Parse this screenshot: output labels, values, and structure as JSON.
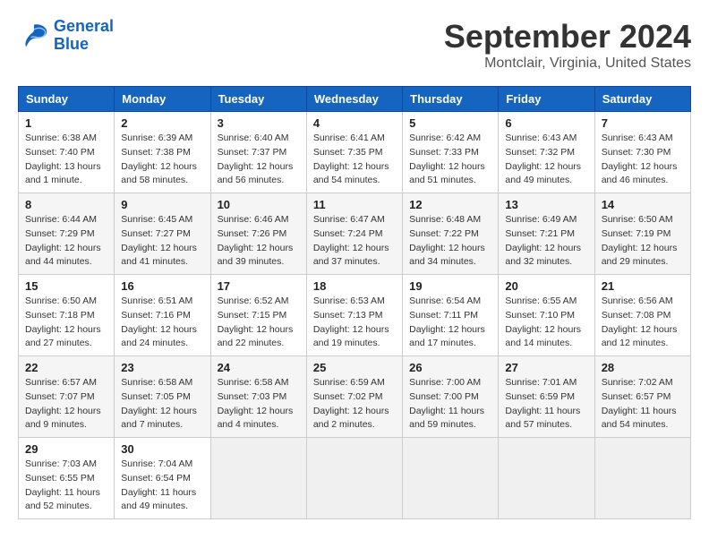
{
  "header": {
    "logo_line1": "General",
    "logo_line2": "Blue",
    "title": "September 2024",
    "subtitle": "Montclair, Virginia, United States"
  },
  "columns": [
    "Sunday",
    "Monday",
    "Tuesday",
    "Wednesday",
    "Thursday",
    "Friday",
    "Saturday"
  ],
  "weeks": [
    [
      {
        "day": "1",
        "info": "Sunrise: 6:38 AM\nSunset: 7:40 PM\nDaylight: 13 hours\nand 1 minute."
      },
      {
        "day": "2",
        "info": "Sunrise: 6:39 AM\nSunset: 7:38 PM\nDaylight: 12 hours\nand 58 minutes."
      },
      {
        "day": "3",
        "info": "Sunrise: 6:40 AM\nSunset: 7:37 PM\nDaylight: 12 hours\nand 56 minutes."
      },
      {
        "day": "4",
        "info": "Sunrise: 6:41 AM\nSunset: 7:35 PM\nDaylight: 12 hours\nand 54 minutes."
      },
      {
        "day": "5",
        "info": "Sunrise: 6:42 AM\nSunset: 7:33 PM\nDaylight: 12 hours\nand 51 minutes."
      },
      {
        "day": "6",
        "info": "Sunrise: 6:43 AM\nSunset: 7:32 PM\nDaylight: 12 hours\nand 49 minutes."
      },
      {
        "day": "7",
        "info": "Sunrise: 6:43 AM\nSunset: 7:30 PM\nDaylight: 12 hours\nand 46 minutes."
      }
    ],
    [
      {
        "day": "8",
        "info": "Sunrise: 6:44 AM\nSunset: 7:29 PM\nDaylight: 12 hours\nand 44 minutes."
      },
      {
        "day": "9",
        "info": "Sunrise: 6:45 AM\nSunset: 7:27 PM\nDaylight: 12 hours\nand 41 minutes."
      },
      {
        "day": "10",
        "info": "Sunrise: 6:46 AM\nSunset: 7:26 PM\nDaylight: 12 hours\nand 39 minutes."
      },
      {
        "day": "11",
        "info": "Sunrise: 6:47 AM\nSunset: 7:24 PM\nDaylight: 12 hours\nand 37 minutes."
      },
      {
        "day": "12",
        "info": "Sunrise: 6:48 AM\nSunset: 7:22 PM\nDaylight: 12 hours\nand 34 minutes."
      },
      {
        "day": "13",
        "info": "Sunrise: 6:49 AM\nSunset: 7:21 PM\nDaylight: 12 hours\nand 32 minutes."
      },
      {
        "day": "14",
        "info": "Sunrise: 6:50 AM\nSunset: 7:19 PM\nDaylight: 12 hours\nand 29 minutes."
      }
    ],
    [
      {
        "day": "15",
        "info": "Sunrise: 6:50 AM\nSunset: 7:18 PM\nDaylight: 12 hours\nand 27 minutes."
      },
      {
        "day": "16",
        "info": "Sunrise: 6:51 AM\nSunset: 7:16 PM\nDaylight: 12 hours\nand 24 minutes."
      },
      {
        "day": "17",
        "info": "Sunrise: 6:52 AM\nSunset: 7:15 PM\nDaylight: 12 hours\nand 22 minutes."
      },
      {
        "day": "18",
        "info": "Sunrise: 6:53 AM\nSunset: 7:13 PM\nDaylight: 12 hours\nand 19 minutes."
      },
      {
        "day": "19",
        "info": "Sunrise: 6:54 AM\nSunset: 7:11 PM\nDaylight: 12 hours\nand 17 minutes."
      },
      {
        "day": "20",
        "info": "Sunrise: 6:55 AM\nSunset: 7:10 PM\nDaylight: 12 hours\nand 14 minutes."
      },
      {
        "day": "21",
        "info": "Sunrise: 6:56 AM\nSunset: 7:08 PM\nDaylight: 12 hours\nand 12 minutes."
      }
    ],
    [
      {
        "day": "22",
        "info": "Sunrise: 6:57 AM\nSunset: 7:07 PM\nDaylight: 12 hours\nand 9 minutes."
      },
      {
        "day": "23",
        "info": "Sunrise: 6:58 AM\nSunset: 7:05 PM\nDaylight: 12 hours\nand 7 minutes."
      },
      {
        "day": "24",
        "info": "Sunrise: 6:58 AM\nSunset: 7:03 PM\nDaylight: 12 hours\nand 4 minutes."
      },
      {
        "day": "25",
        "info": "Sunrise: 6:59 AM\nSunset: 7:02 PM\nDaylight: 12 hours\nand 2 minutes."
      },
      {
        "day": "26",
        "info": "Sunrise: 7:00 AM\nSunset: 7:00 PM\nDaylight: 11 hours\nand 59 minutes."
      },
      {
        "day": "27",
        "info": "Sunrise: 7:01 AM\nSunset: 6:59 PM\nDaylight: 11 hours\nand 57 minutes."
      },
      {
        "day": "28",
        "info": "Sunrise: 7:02 AM\nSunset: 6:57 PM\nDaylight: 11 hours\nand 54 minutes."
      }
    ],
    [
      {
        "day": "29",
        "info": "Sunrise: 7:03 AM\nSunset: 6:55 PM\nDaylight: 11 hours\nand 52 minutes."
      },
      {
        "day": "30",
        "info": "Sunrise: 7:04 AM\nSunset: 6:54 PM\nDaylight: 11 hours\nand 49 minutes."
      },
      {
        "day": "",
        "info": ""
      },
      {
        "day": "",
        "info": ""
      },
      {
        "day": "",
        "info": ""
      },
      {
        "day": "",
        "info": ""
      },
      {
        "day": "",
        "info": ""
      }
    ]
  ]
}
